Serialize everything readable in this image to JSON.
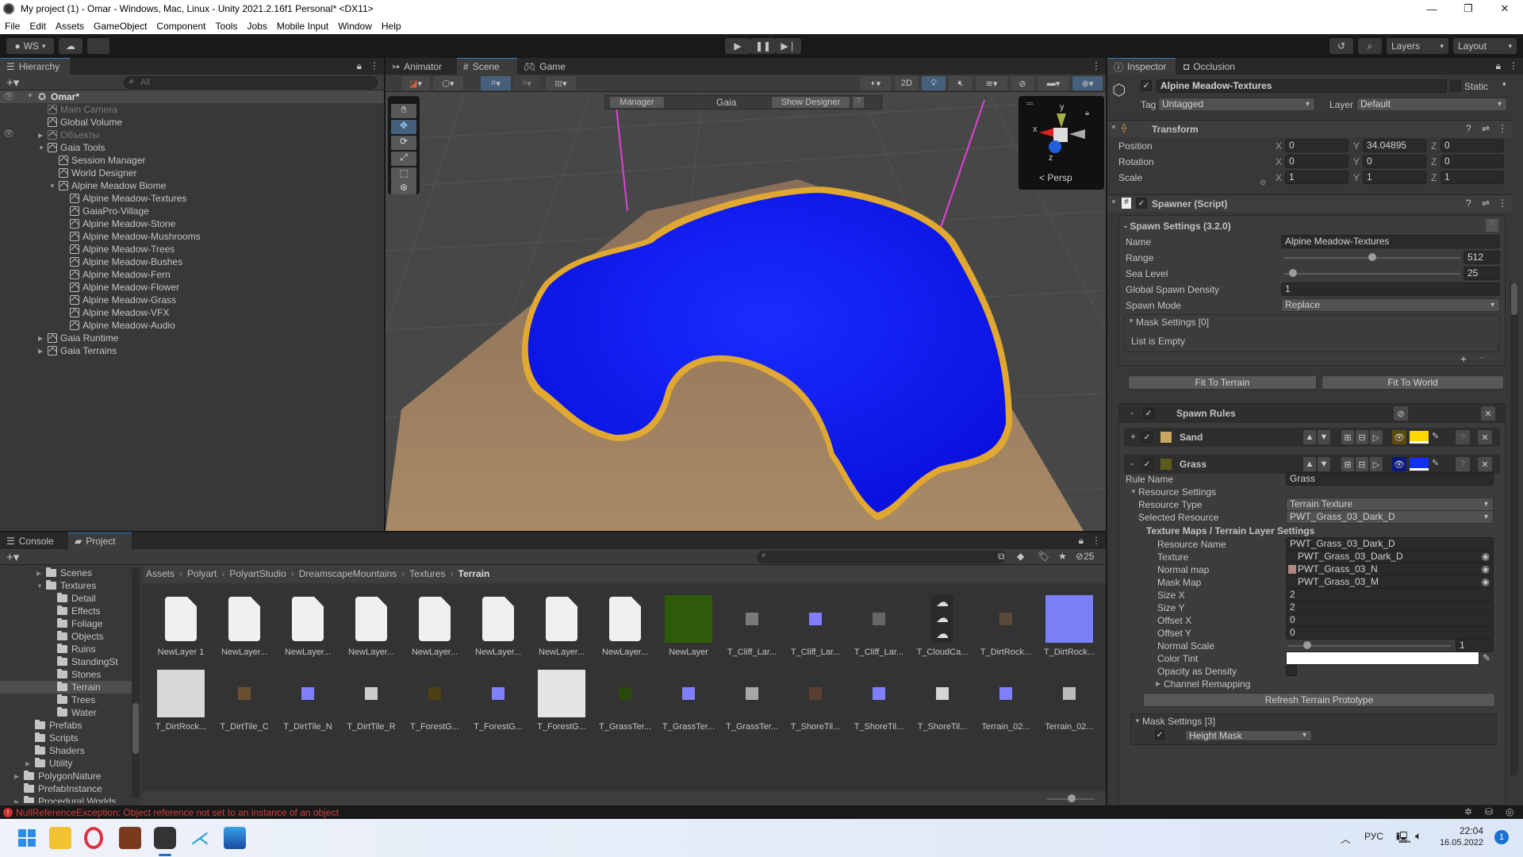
{
  "window": {
    "title": "My project (1) - Omar - Windows, Mac, Linux - Unity 2021.2.16f1 Personal* <DX11>",
    "controls": [
      "minimize",
      "maximize",
      "close"
    ]
  },
  "menu": [
    "File",
    "Edit",
    "Assets",
    "GameObject",
    "Component",
    "Tools",
    "Jobs",
    "Mobile Input",
    "Window",
    "Help"
  ],
  "toolbar": {
    "account": "WS",
    "play_controls": [
      "play",
      "pause",
      "step"
    ],
    "layers_label": "Layers",
    "layout_label": "Layout"
  },
  "hierarchy": {
    "tab": "Hierarchy",
    "search_placeholder": "All",
    "scene": "Omar*",
    "items": [
      {
        "label": "Main Camera",
        "depth": 1,
        "dim": true,
        "arrow": ""
      },
      {
        "label": "Global Volume",
        "depth": 1,
        "dim": false,
        "arrow": ""
      },
      {
        "label": "Объекты",
        "depth": 1,
        "dim": true,
        "arrow": "▶"
      },
      {
        "label": "Gaia Tools",
        "depth": 1,
        "dim": false,
        "arrow": "▼"
      },
      {
        "label": "Session Manager",
        "depth": 2,
        "dim": false,
        "arrow": ""
      },
      {
        "label": "World Designer",
        "depth": 2,
        "dim": false,
        "arrow": ""
      },
      {
        "label": "Alpine Meadow Biome",
        "depth": 2,
        "dim": false,
        "arrow": "▼"
      },
      {
        "label": "Alpine Meadow-Textures",
        "depth": 3,
        "dim": false,
        "arrow": ""
      },
      {
        "label": "GaiaPro-Village",
        "depth": 3,
        "dim": false,
        "arrow": ""
      },
      {
        "label": "Alpine Meadow-Stone",
        "depth": 3,
        "dim": false,
        "arrow": ""
      },
      {
        "label": "Alpine Meadow-Mushrooms",
        "depth": 3,
        "dim": false,
        "arrow": ""
      },
      {
        "label": "Alpine Meadow-Trees",
        "depth": 3,
        "dim": false,
        "arrow": ""
      },
      {
        "label": "Alpine Meadow-Bushes",
        "depth": 3,
        "dim": false,
        "arrow": ""
      },
      {
        "label": "Alpine Meadow-Fern",
        "depth": 3,
        "dim": false,
        "arrow": ""
      },
      {
        "label": "Alpine Meadow-Flower",
        "depth": 3,
        "dim": false,
        "arrow": ""
      },
      {
        "label": "Alpine Meadow-Grass",
        "depth": 3,
        "dim": false,
        "arrow": ""
      },
      {
        "label": "Alpine Meadow-VFX",
        "depth": 3,
        "dim": false,
        "arrow": ""
      },
      {
        "label": "Alpine Meadow-Audio",
        "depth": 3,
        "dim": false,
        "arrow": ""
      },
      {
        "label": "Gaia Runtime",
        "depth": 1,
        "dim": false,
        "arrow": "▶"
      },
      {
        "label": "Gaia Terrains",
        "depth": 1,
        "dim": false,
        "arrow": "▶"
      }
    ]
  },
  "scene": {
    "tabs": [
      "Animator",
      "Scene",
      "Game"
    ],
    "active_tab": "Scene",
    "toggle_2d": "2D",
    "gaia_overlay": {
      "manager": "Manager",
      "title": "Gaia",
      "show_designer": "Show Designer",
      "help": "?"
    },
    "gizmo": {
      "x": "x",
      "y": "y",
      "z": "z",
      "projection": "Persp"
    },
    "tools": [
      "hand",
      "move",
      "rotate",
      "scale",
      "rect",
      "transform"
    ],
    "colors": {
      "grass": "#0a14f0",
      "sand": "#e8b030",
      "terrain": "#9a7a5a"
    }
  },
  "inspector": {
    "tabs": [
      "Inspector",
      "Occlusion"
    ],
    "object_name": "Alpine Meadow-Textures",
    "active": true,
    "static_label": "Static",
    "tag_label": "Tag",
    "tag": "Untagged",
    "layer_label": "Layer",
    "layer": "Default",
    "transform": {
      "title": "Transform",
      "rows": [
        {
          "label": "Position",
          "x": "0",
          "y": "34.04895",
          "z": "0"
        },
        {
          "label": "Rotation",
          "x": "0",
          "y": "0",
          "z": "0"
        },
        {
          "label": "Scale",
          "x": "1",
          "y": "1",
          "z": "1"
        }
      ]
    },
    "spawner": {
      "title": "Spawner (Script)",
      "settings_title": "- Spawn Settings  (3.2.0)",
      "name_label": "Name",
      "name": "Alpine Meadow-Textures",
      "range_label": "Range",
      "range": "512",
      "range_fraction": 0.5,
      "sea_level_label": "Sea Level",
      "sea_level": "25",
      "sea_level_fraction": 0.05,
      "density_label": "Global Spawn Density",
      "density": "1",
      "mode_label": "Spawn Mode",
      "mode": "Replace",
      "mask_settings": "Mask Settings [0]",
      "list_empty": "List is Empty",
      "fit_terrain": "Fit To Terrain",
      "fit_world": "Fit To World",
      "rules_title": "Spawn Rules",
      "rules": [
        {
          "expand": "+",
          "name": "Sand",
          "swatch": "#c8a860",
          "color": "#ffd800"
        },
        {
          "expand": "-",
          "name": "Grass",
          "swatch": "#5c5c20",
          "color": "#1030ff"
        }
      ],
      "rule": {
        "rule_name_label": "Rule Name",
        "rule_name": "Grass",
        "resource_settings": "Resource Settings",
        "resource_type_label": "Resource Type",
        "resource_type": "Terrain Texture",
        "selected_resource_label": "Selected Resource",
        "selected_resource": "PWT_Grass_03_Dark_D",
        "texture_maps_title": "Texture Maps / Terrain Layer Settings",
        "resource_name_label": "Resource Name",
        "resource_name": "PWT_Grass_03_Dark_D",
        "texture_label": "Texture",
        "texture": "PWT_Grass_03_Dark_D",
        "normal_label": "Normal map",
        "normal": "PWT_Grass_03_N",
        "mask_label": "Mask Map",
        "mask": "PWT_Grass_03_M",
        "size_x_label": "Size X",
        "size_x": "2",
        "size_y_label": "Size Y",
        "size_y": "2",
        "offset_x_label": "Offset X",
        "offset_x": "0",
        "offset_y_label": "Offset Y",
        "offset_y": "0",
        "normal_scale_label": "Normal Scale",
        "normal_scale": "1",
        "normal_scale_fraction": 0.12,
        "color_tint_label": "Color Tint",
        "color_tint": "#ffffff",
        "opacity_label": "Opacity as Density",
        "opacity_checked": false,
        "channel_remapping": "Channel Remapping",
        "refresh": "Refresh Terrain Prototype",
        "mask_settings": "Mask Settings [3]",
        "first_mask": "Height Mask"
      }
    }
  },
  "project": {
    "tabs": [
      "Console",
      "Project"
    ],
    "active_tab": "Project",
    "hidden_count": "25",
    "breadcrumb": [
      "Assets",
      "Polyart",
      "PolyartStudio",
      "DreamscapeMountains",
      "Textures",
      "Terrain"
    ],
    "tree": [
      {
        "label": "Scenes",
        "depth": 2,
        "arrow": "▶"
      },
      {
        "label": "Textures",
        "depth": 2,
        "arrow": "▼"
      },
      {
        "label": "Detail",
        "depth": 3,
        "arrow": ""
      },
      {
        "label": "Effects",
        "depth": 3,
        "arrow": ""
      },
      {
        "label": "Foliage",
        "depth": 3,
        "arrow": ""
      },
      {
        "label": "Objects",
        "depth": 3,
        "arrow": ""
      },
      {
        "label": "Ruins",
        "depth": 3,
        "arrow": ""
      },
      {
        "label": "StandingSt",
        "depth": 3,
        "arrow": ""
      },
      {
        "label": "Stones",
        "depth": 3,
        "arrow": ""
      },
      {
        "label": "Terrain",
        "depth": 3,
        "arrow": "",
        "selected": true
      },
      {
        "label": "Trees",
        "depth": 3,
        "arrow": ""
      },
      {
        "label": "Water",
        "depth": 3,
        "arrow": ""
      },
      {
        "label": "Prefabs",
        "depth": 1,
        "arrow": ""
      },
      {
        "label": "Scripts",
        "depth": 1,
        "arrow": ""
      },
      {
        "label": "Shaders",
        "depth": 1,
        "arrow": ""
      },
      {
        "label": "Utility",
        "depth": 1,
        "arrow": "▶"
      },
      {
        "label": "PolygonNature",
        "depth": 0,
        "arrow": "▶"
      },
      {
        "label": "PrefabInstance",
        "depth": 0,
        "arrow": ""
      },
      {
        "label": "Procedural Worlds",
        "depth": 0,
        "arrow": "▶"
      }
    ],
    "assets": [
      {
        "name": "NewLayer 1",
        "kind": "doc"
      },
      {
        "name": "NewLayer...",
        "kind": "doc"
      },
      {
        "name": "NewLayer...",
        "kind": "doc"
      },
      {
        "name": "NewLayer...",
        "kind": "doc"
      },
      {
        "name": "NewLayer...",
        "kind": "doc"
      },
      {
        "name": "NewLayer...",
        "kind": "doc"
      },
      {
        "name": "NewLayer...",
        "kind": "doc"
      },
      {
        "name": "NewLayer...",
        "kind": "doc"
      },
      {
        "name": "NewLayer",
        "kind": "big",
        "color": "#2f5a0a"
      },
      {
        "name": "T_Cliff_Lar...",
        "kind": "small",
        "color": "#7a7a7a"
      },
      {
        "name": "T_Cliff_Lar...",
        "kind": "small",
        "color": "#8080ff"
      },
      {
        "name": "T_Cliff_Lar...",
        "kind": "small",
        "color": "#666666"
      },
      {
        "name": "T_CloudCa...",
        "kind": "cloud"
      },
      {
        "name": "T_DirtRock...",
        "kind": "small",
        "color": "#5a4a3a"
      },
      {
        "name": "T_DirtRock...",
        "kind": "big",
        "color": "#7a80f8"
      },
      {
        "name": "T_DirtRock...",
        "kind": "big",
        "color": "#d8d8d8"
      },
      {
        "name": "T_DirtTile_C",
        "kind": "small",
        "color": "#6a5030"
      },
      {
        "name": "T_DirtTile_N",
        "kind": "small",
        "color": "#8080ff"
      },
      {
        "name": "T_DirtTile_R",
        "kind": "small",
        "color": "#cccccc"
      },
      {
        "name": "T_ForestG...",
        "kind": "small",
        "color": "#4a4010"
      },
      {
        "name": "T_ForestG...",
        "kind": "small",
        "color": "#8080ff"
      },
      {
        "name": "T_ForestG...",
        "kind": "big",
        "color": "#e4e4e4"
      },
      {
        "name": "T_GrassTer...",
        "kind": "small",
        "color": "#2a4a0a"
      },
      {
        "name": "T_GrassTer...",
        "kind": "small",
        "color": "#8080ff"
      },
      {
        "name": "T_GrassTer...",
        "kind": "small",
        "color": "#a8a8a8"
      },
      {
        "name": "T_ShoreTil...",
        "kind": "small",
        "color": "#5a4030"
      },
      {
        "name": "T_ShoreTil...",
        "kind": "small",
        "color": "#8080ff"
      },
      {
        "name": "T_ShoreTil...",
        "kind": "small",
        "color": "#d4d4d4"
      },
      {
        "name": "Terrain_02...",
        "kind": "small",
        "color": "#8080ff"
      },
      {
        "name": "Terrain_02...",
        "kind": "small",
        "color": "#bcbcbc"
      }
    ]
  },
  "status": {
    "error": "NullReferenceException: Object reference not set to an instance of an object"
  },
  "taskbar": {
    "apps": [
      "start",
      "file-explorer",
      "opera",
      "blender",
      "unity",
      "acrobat",
      "photos"
    ],
    "language": "РУС",
    "time": "22:04",
    "date": "16.05.2022",
    "notifications": "1"
  }
}
